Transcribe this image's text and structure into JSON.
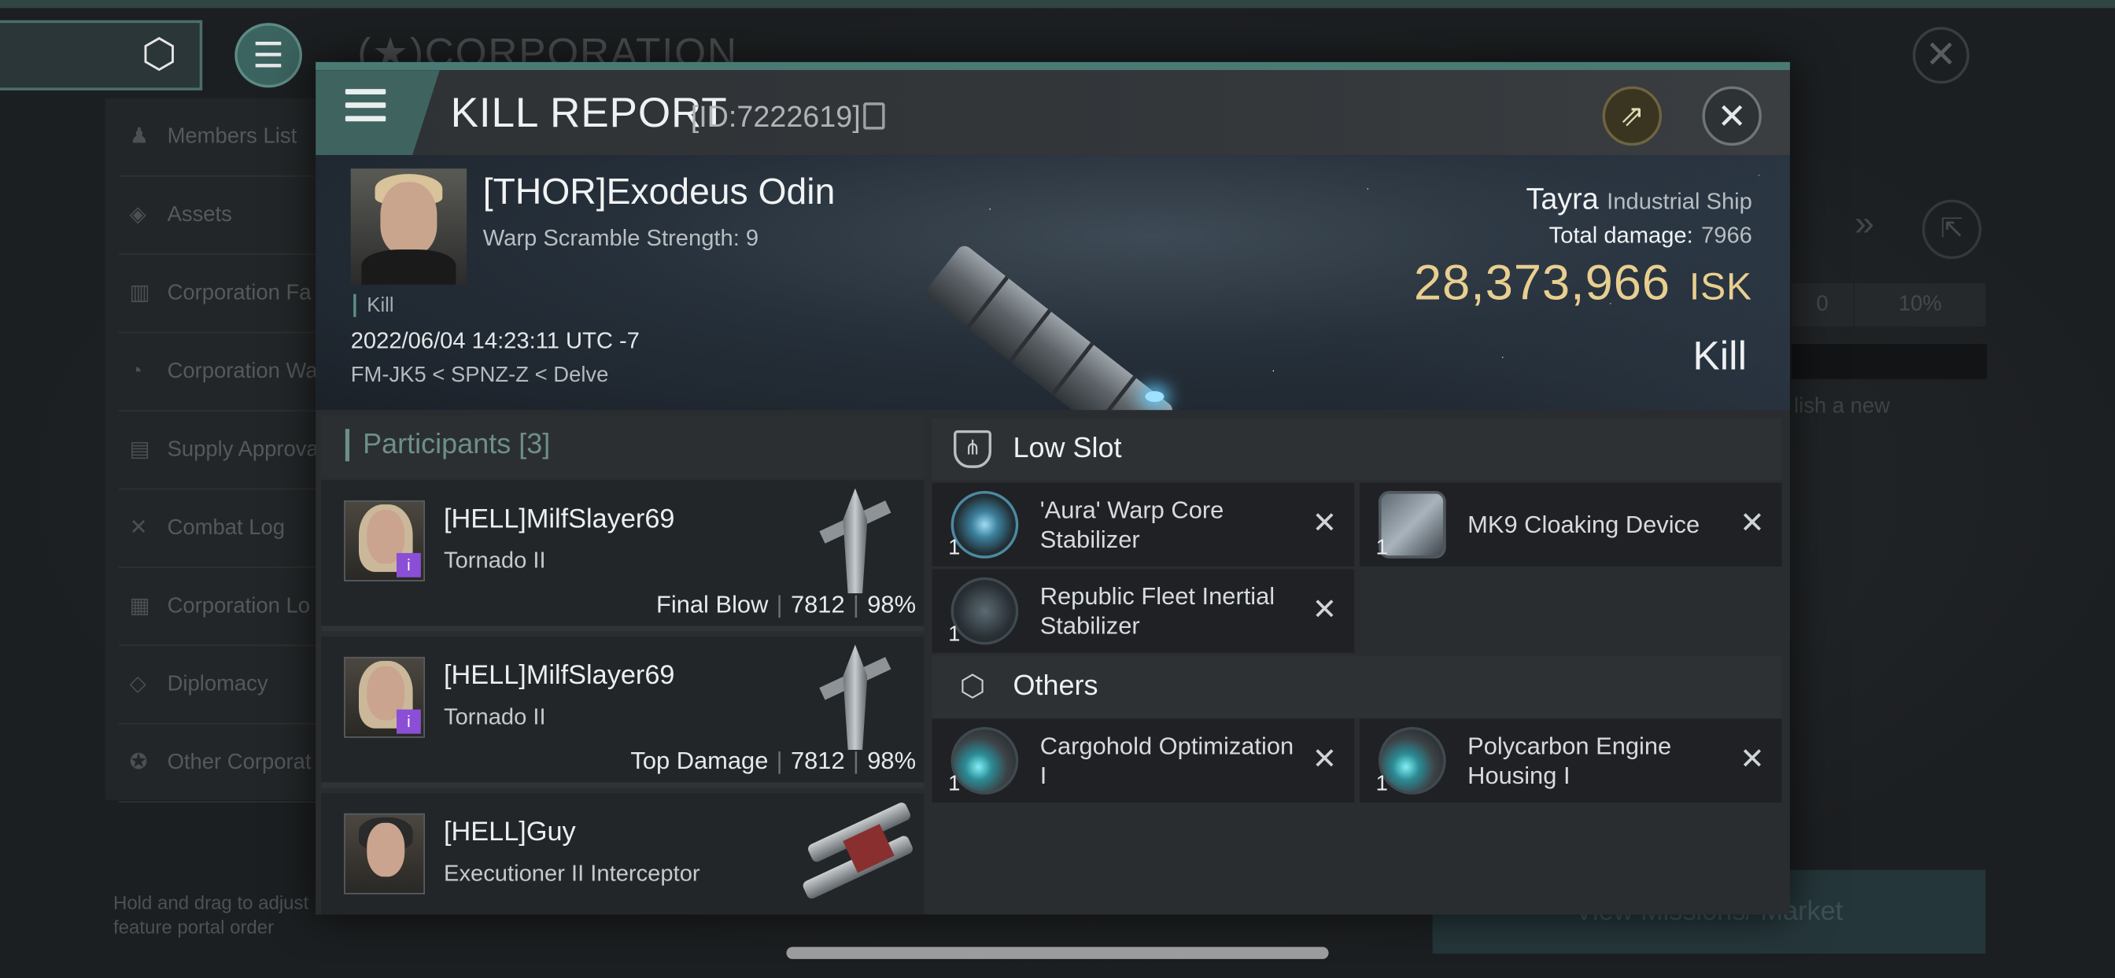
{
  "background": {
    "title": "(★)CORPORATION",
    "sidebar": [
      {
        "label": "Members List",
        "icon": "members-icon"
      },
      {
        "label": "Assets",
        "icon": "assets-icon"
      },
      {
        "label": "Corporation Fa",
        "icon": "facilities-icon"
      },
      {
        "label": "Corporation Wa",
        "icon": "wallet-icon"
      },
      {
        "label": "Supply Approva",
        "icon": "supply-icon"
      },
      {
        "label": "Combat Log",
        "icon": "combat-log-icon"
      },
      {
        "label": "Corporation Lo",
        "icon": "corp-log-icon"
      },
      {
        "label": "Diplomacy",
        "icon": "diplomacy-icon"
      },
      {
        "label": "Other Corporat",
        "icon": "other-corp-icon"
      }
    ],
    "hint": "Hold and drag to adjust feature portal order",
    "right_value": "0",
    "right_pct": "10%",
    "right_text": "lish a new",
    "bottom_button": "View Missions/ Market"
  },
  "report": {
    "title": "KILL REPORT",
    "id": "[ID:7222619]",
    "victim": {
      "name": "[THOR]Exodeus Odin",
      "scram": "Warp Scramble Strength: 9",
      "tag": "Kill",
      "date": "2022/06/04 14:23:11 UTC -7",
      "location": "FM-JK5 < SPNZ-Z < Delve"
    },
    "ship": {
      "name": "Tayra",
      "class": "Industrial Ship",
      "total_damage_label": "Total damage:",
      "total_damage": "7966",
      "isk_value": "28,373,966",
      "isk_unit": "ISK",
      "result": "Kill"
    },
    "participants": {
      "label": "Participants",
      "count": "[3]",
      "rows": [
        {
          "name": "[HELL]MilfSlayer69",
          "ship": "Tornado II",
          "role": "Final Blow",
          "damage": "7812",
          "pct": "98%"
        },
        {
          "name": "[HELL]MilfSlayer69",
          "ship": "Tornado II",
          "role": "Top Damage",
          "damage": "7812",
          "pct": "98%"
        },
        {
          "name": "[HELL]Guy",
          "ship": "Executioner II Interceptor"
        }
      ]
    },
    "low_slot": {
      "label": "Low Slot",
      "items": [
        {
          "qty": "1",
          "name": "'Aura' Warp Core Stabilizer"
        },
        {
          "qty": "1",
          "name": "MK9 Cloaking Device"
        },
        {
          "qty": "1",
          "name": "Republic Fleet Inertial Stabilizer"
        }
      ]
    },
    "others": {
      "label": "Others",
      "items": [
        {
          "qty": "1",
          "name": "Cargohold Optimization I"
        },
        {
          "qty": "1",
          "name": "Polycarbon Engine Housing I"
        }
      ]
    }
  },
  "colors": {
    "accent": "#4a7a74",
    "isk": "#e9cf8f",
    "participants_label": "#6d8f89"
  }
}
